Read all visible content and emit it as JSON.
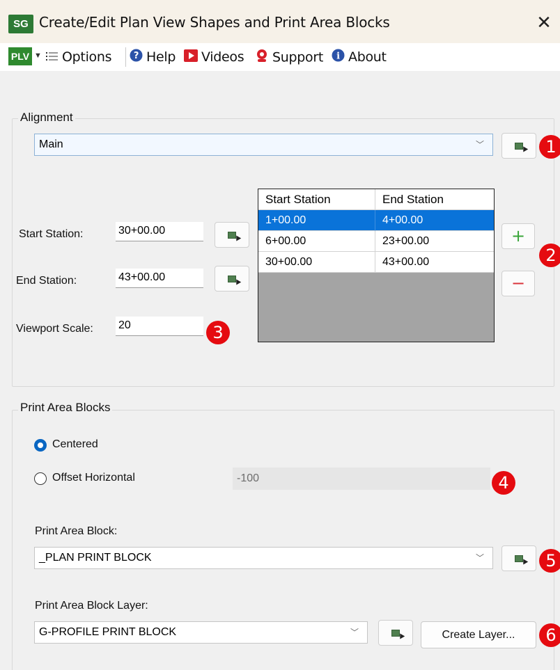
{
  "window": {
    "app_logo": "SG",
    "title": "Create/Edit Plan View Shapes and Print Area Blocks",
    "close": "✕"
  },
  "menubar": {
    "logo": "PLV",
    "items": [
      {
        "label": "Options",
        "icon": "list-icon"
      },
      {
        "label": "Help",
        "icon": "help-icon"
      },
      {
        "label": "Videos",
        "icon": "video-icon"
      },
      {
        "label": "Support",
        "icon": "support-icon"
      },
      {
        "label": "About",
        "icon": "info-icon"
      }
    ]
  },
  "alignment": {
    "group_title": "Alignment",
    "selected": "Main",
    "start_station_label": "Start Station:",
    "start_station_value": "30+00.00",
    "end_station_label": "End Station:",
    "end_station_value": "43+00.00",
    "viewport_scale_label": "Viewport Scale:",
    "viewport_scale_value": "20"
  },
  "station_table": {
    "headers": [
      "Start Station",
      "End Station"
    ],
    "rows": [
      [
        "1+00.00",
        "4+00.00"
      ],
      [
        "6+00.00",
        "23+00.00"
      ],
      [
        "30+00.00",
        "43+00.00"
      ]
    ],
    "selected_row": 0
  },
  "buttons": {
    "add": "+",
    "remove": "−",
    "create_layer": "Create Layer..."
  },
  "print_area": {
    "group_title": "Print Area Blocks",
    "centered_label": "Centered",
    "offset_label": "Offset Horizontal",
    "offset_value": "-100",
    "block_label": "Print Area Block:",
    "block_value": "_PLAN PRINT BLOCK",
    "layer_label": "Print Area Block Layer:",
    "layer_value": "G-PROFILE PRINT BLOCK"
  },
  "badges": [
    "1",
    "2",
    "3",
    "4",
    "5",
    "6"
  ],
  "colors": {
    "accent": "#0a73d9",
    "badge": "#e50b10",
    "add_green": "#3aa53a",
    "remove_red": "#d9343b"
  }
}
